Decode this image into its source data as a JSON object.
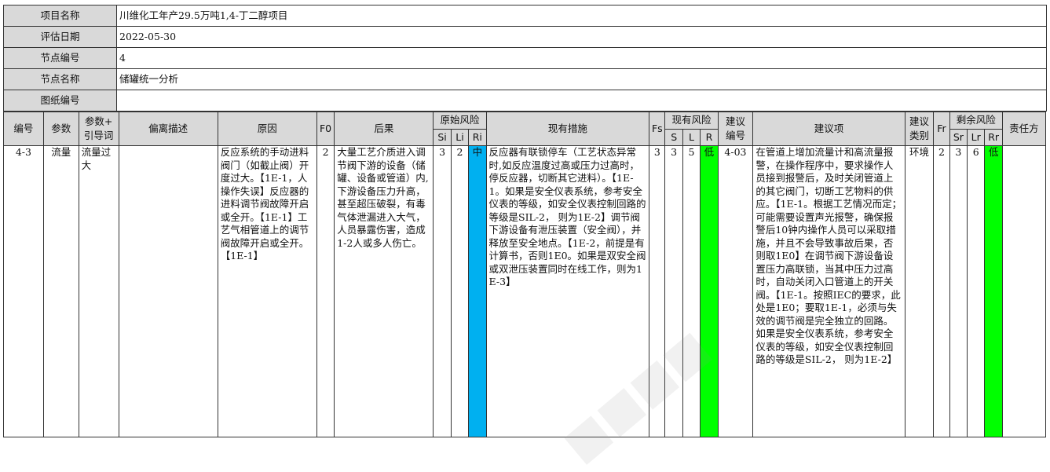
{
  "info": {
    "project_label": "项目名称",
    "project_value": "川维化工年产29.5万吨1,4-丁二醇项目",
    "date_label": "评估日期",
    "date_value": "2022-05-30",
    "node_no_label": "节点编号",
    "node_no_value": "4",
    "node_name_label": "节点名称",
    "node_name_value": "储罐统一分析",
    "drawing_label": "图纸编号",
    "drawing_value": ""
  },
  "headers": {
    "no": "编号",
    "param": "参数",
    "param_guide_1": "参数+",
    "param_guide_2": "引导词",
    "deviation": "偏离描述",
    "cause": "原因",
    "f0": "F0",
    "consequence": "后果",
    "orig_risk": "原始风险",
    "si": "Si",
    "li": "Li",
    "ri": "Ri",
    "measures": "现有措施",
    "fs": "Fs",
    "curr_risk": "现有风险",
    "s": "S",
    "l": "L",
    "r": "R",
    "sugg_no_1": "建议",
    "sugg_no_2": "编号",
    "suggestion": "建议项",
    "sugg_type_1": "建议",
    "sugg_type_2": "类别",
    "fr": "Fr",
    "resid_risk": "剩余风险",
    "sr": "Sr",
    "lr": "Lr",
    "rr": "Rr",
    "owner": "责任方"
  },
  "row": {
    "no": "4-3",
    "param": "流量",
    "param_guide": "流量过大",
    "deviation": "",
    "cause": "反应系统的手动进料阀门（如截止阀）开度过大。【1E-1，人操作失误】反应器的进料调节阀故障开启或全开。【1E-1】工艺气相管道上的调节阀故障开启或全开。【1E-1】",
    "f0": "2",
    "consequence": "大量工艺介质进入调节阀下游的设备（储罐、设备或管道）内,下游设备压力升高，甚至超压破裂，有毒气体泄漏进入大气，人员暴露伤害，造成1-2人或多人伤亡。",
    "si": "3",
    "li": "2",
    "ri": "中",
    "measures": "反应器有联锁停车（工艺状态异常时,如反应温度过高或压力过高时，停反应器，切断其它进料）。【1E-1。如果是安全仪表系统，参考安全仪表的等级，如安全仪表控制回路的等级是SIL-2， 则为1E-2】调节阀下游设备有泄压装置（安全阀），并释放至安全地点。【1E-2，前提是有计算书，否则1E0。如果是双安全阀或双泄压装置同时在线工作，则为1E-3】",
    "fs": "3",
    "s": "3",
    "l": "5",
    "r": "低",
    "sugg_no": "4-03",
    "suggestion": "在管道上增加流量计和高流量报警，在操作程序中，要求操作人员接到报警后，及时关闭管道上的其它阀门，切断工艺物料的供应。【1E-1。根据工艺情况而定；可能需要设置声光报警，确保报警后10钟内操作人员可以采取措施，并且不会导致事故后果，否则取1E0】在调节阀下游设备设置压力高联锁，当其中压力过高时，自动关闭入口管道上的开关阀。【1E-1。按照IEC的要求，此处是1E0；要取1E-1，必须与失效的调节阀是完全独立的回路。如果是安全仪表系统，参考安全仪表的等级，如安全仪表控制回路的等级是SIL-2， 则为1E-2】",
    "sugg_type": "环境",
    "fr": "2",
    "sr": "3",
    "lr": "6",
    "rr": "低",
    "owner": ""
  },
  "colors": {
    "header_bg": "#d9d9d9",
    "risk_medium": "#00b0f0",
    "risk_low": "#00ff00"
  }
}
